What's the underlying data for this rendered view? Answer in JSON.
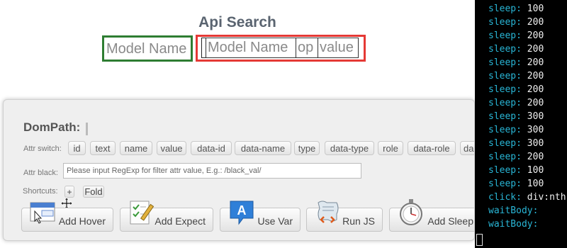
{
  "page": {
    "title": "Api Search"
  },
  "search": {
    "model_name_placeholder": "Model Name",
    "fields": [
      {
        "placeholder": "Model Name"
      },
      {
        "placeholder": "op"
      },
      {
        "placeholder": "value"
      }
    ]
  },
  "panel": {
    "title": "DomPath:",
    "attr_switch_label": "Attr switch:",
    "attr_chips": [
      "id",
      "text",
      "name",
      "value",
      "data-id",
      "data-name",
      "type",
      "data-type",
      "role",
      "data-role",
      "da"
    ],
    "attr_black_label": "Attr black:",
    "attr_black_placeholder": "Please input RegExp for filter attr value, E.g.: /black_val/",
    "shortcuts_label": "Shortcuts:",
    "plus_label": "+",
    "fold_label": "Fold",
    "actions": [
      {
        "label": "Add Hover",
        "icon": "hover-icon"
      },
      {
        "label": "Add Expect",
        "icon": "expect-icon"
      },
      {
        "label": "Use Var",
        "icon": "variable-icon"
      },
      {
        "label": "Run JS",
        "icon": "script-icon"
      },
      {
        "label": "Add Sleep",
        "icon": "stopwatch-icon"
      }
    ]
  },
  "terminal": {
    "lines": [
      {
        "key": "sleep:",
        "value": "100"
      },
      {
        "key": "sleep:",
        "value": "200"
      },
      {
        "key": "sleep:",
        "value": "200"
      },
      {
        "key": "sleep:",
        "value": "200"
      },
      {
        "key": "sleep:",
        "value": "200"
      },
      {
        "key": "sleep:",
        "value": "200"
      },
      {
        "key": "sleep:",
        "value": "200"
      },
      {
        "key": "sleep:",
        "value": "200"
      },
      {
        "key": "sleep:",
        "value": "300"
      },
      {
        "key": "sleep:",
        "value": "300"
      },
      {
        "key": "sleep:",
        "value": "300"
      },
      {
        "key": "sleep:",
        "value": "200"
      },
      {
        "key": "sleep:",
        "value": "100"
      },
      {
        "key": "sleep:",
        "value": "100"
      },
      {
        "key": "click:",
        "value": "div:nth"
      },
      {
        "key": "waitBody:",
        "value": ""
      },
      {
        "key": "waitBody:",
        "value": ""
      }
    ]
  },
  "colors": {
    "green_outline": "#2e7d32",
    "red_outline": "#e53935",
    "terminal_key": "#29b6d6"
  }
}
